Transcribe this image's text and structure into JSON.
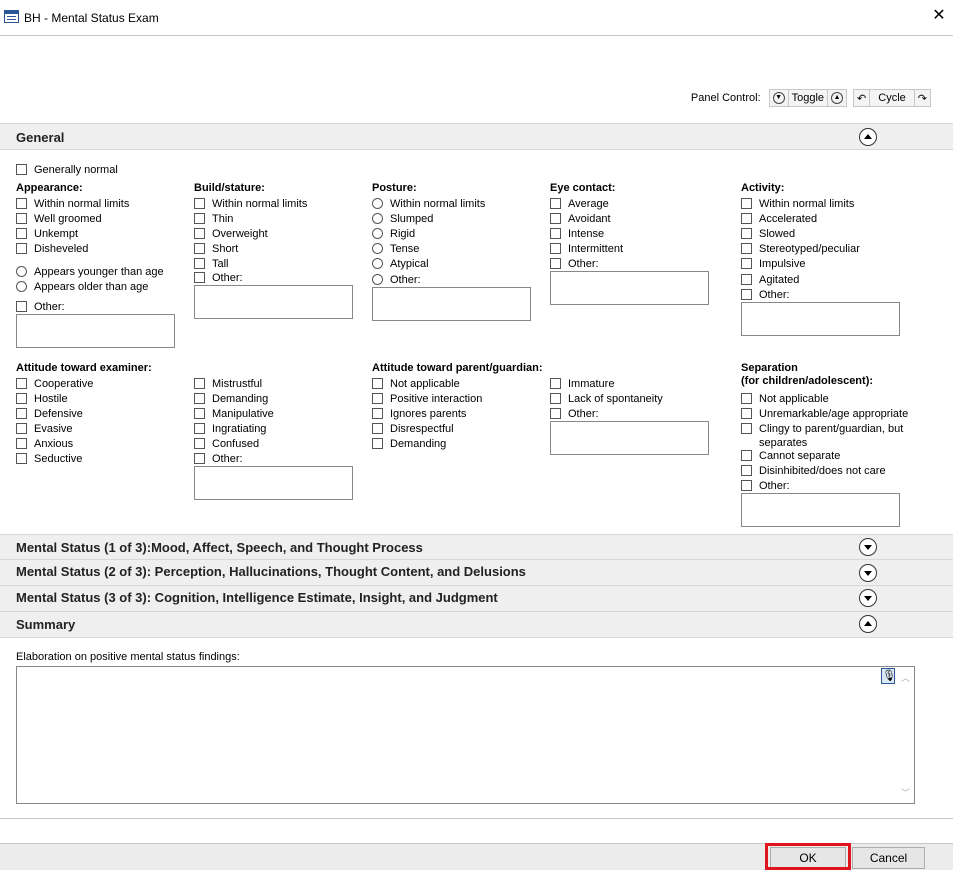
{
  "window": {
    "title": "BH - Mental Status Exam",
    "close": "✕"
  },
  "panel_control": {
    "label": "Panel Control:",
    "toggle": "Toggle",
    "cycle": "Cycle"
  },
  "sections": {
    "general": "General",
    "ms1": "Mental Status (1 of 3):Mood, Affect, Speech, and Thought Process",
    "ms2": "Mental Status (2 of 3): Perception, Hallucinations, Thought Content, and Delusions",
    "ms3": "Mental Status (3 of 3): Cognition, Intelligence Estimate, Insight, and Judgment",
    "summary": "Summary"
  },
  "general": {
    "generally_normal": "Generally normal",
    "appearance": {
      "title": "Appearance:",
      "opts": [
        "Within normal limits",
        "Well groomed",
        "Unkempt",
        "Disheveled"
      ],
      "radios": [
        "Appears younger than age",
        "Appears older than age"
      ],
      "other": "Other:"
    },
    "build": {
      "title": "Build/stature:",
      "opts": [
        "Within normal limits",
        "Thin",
        "Overweight",
        "Short",
        "Tall",
        "Other:"
      ]
    },
    "posture": {
      "title": "Posture:",
      "opts": [
        "Within normal limits",
        "Slumped",
        "Rigid",
        "Tense",
        "Atypical",
        "Other:"
      ]
    },
    "eye": {
      "title": "Eye contact:",
      "opts": [
        "Average",
        "Avoidant",
        "Intense",
        "Intermittent",
        "Other:"
      ]
    },
    "activity": {
      "title": "Activity:",
      "opts": [
        "Within normal limits",
        "Accelerated",
        "Slowed",
        "Stereotyped/peculiar",
        "Impulsive",
        "Agitated",
        "Other:"
      ]
    },
    "attitude_examiner": {
      "title": "Attitude toward examiner:",
      "col1": [
        "Cooperative",
        "Hostile",
        "Defensive",
        "Evasive",
        "Anxious",
        "Seductive"
      ],
      "col2": [
        "Mistrustful",
        "Demanding",
        "Manipulative",
        "Ingratiating",
        "Confused",
        "Other:"
      ]
    },
    "attitude_parent": {
      "title": "Attitude toward parent/guardian:",
      "col1": [
        "Not applicable",
        "Positive interaction",
        "Ignores parents",
        "Disrespectful",
        "Demanding"
      ],
      "col2": [
        "Immature",
        "Lack of spontaneity",
        "Other:"
      ]
    },
    "separation": {
      "title": "Separation",
      "subtitle": "(for children/adolescent):",
      "opts": [
        "Not applicable",
        "Unremarkable/age appropriate",
        "Clingy to parent/guardian, but",
        "separates",
        "Cannot separate",
        "Disinhibited/does not care",
        "Other:"
      ]
    }
  },
  "summary": {
    "label": "Elaboration on positive mental status findings:",
    "value": ""
  },
  "footer": {
    "ok": "OK",
    "cancel": "Cancel"
  },
  "colors": {
    "highlight": "#e0141e",
    "section_bg": "#efefef"
  }
}
